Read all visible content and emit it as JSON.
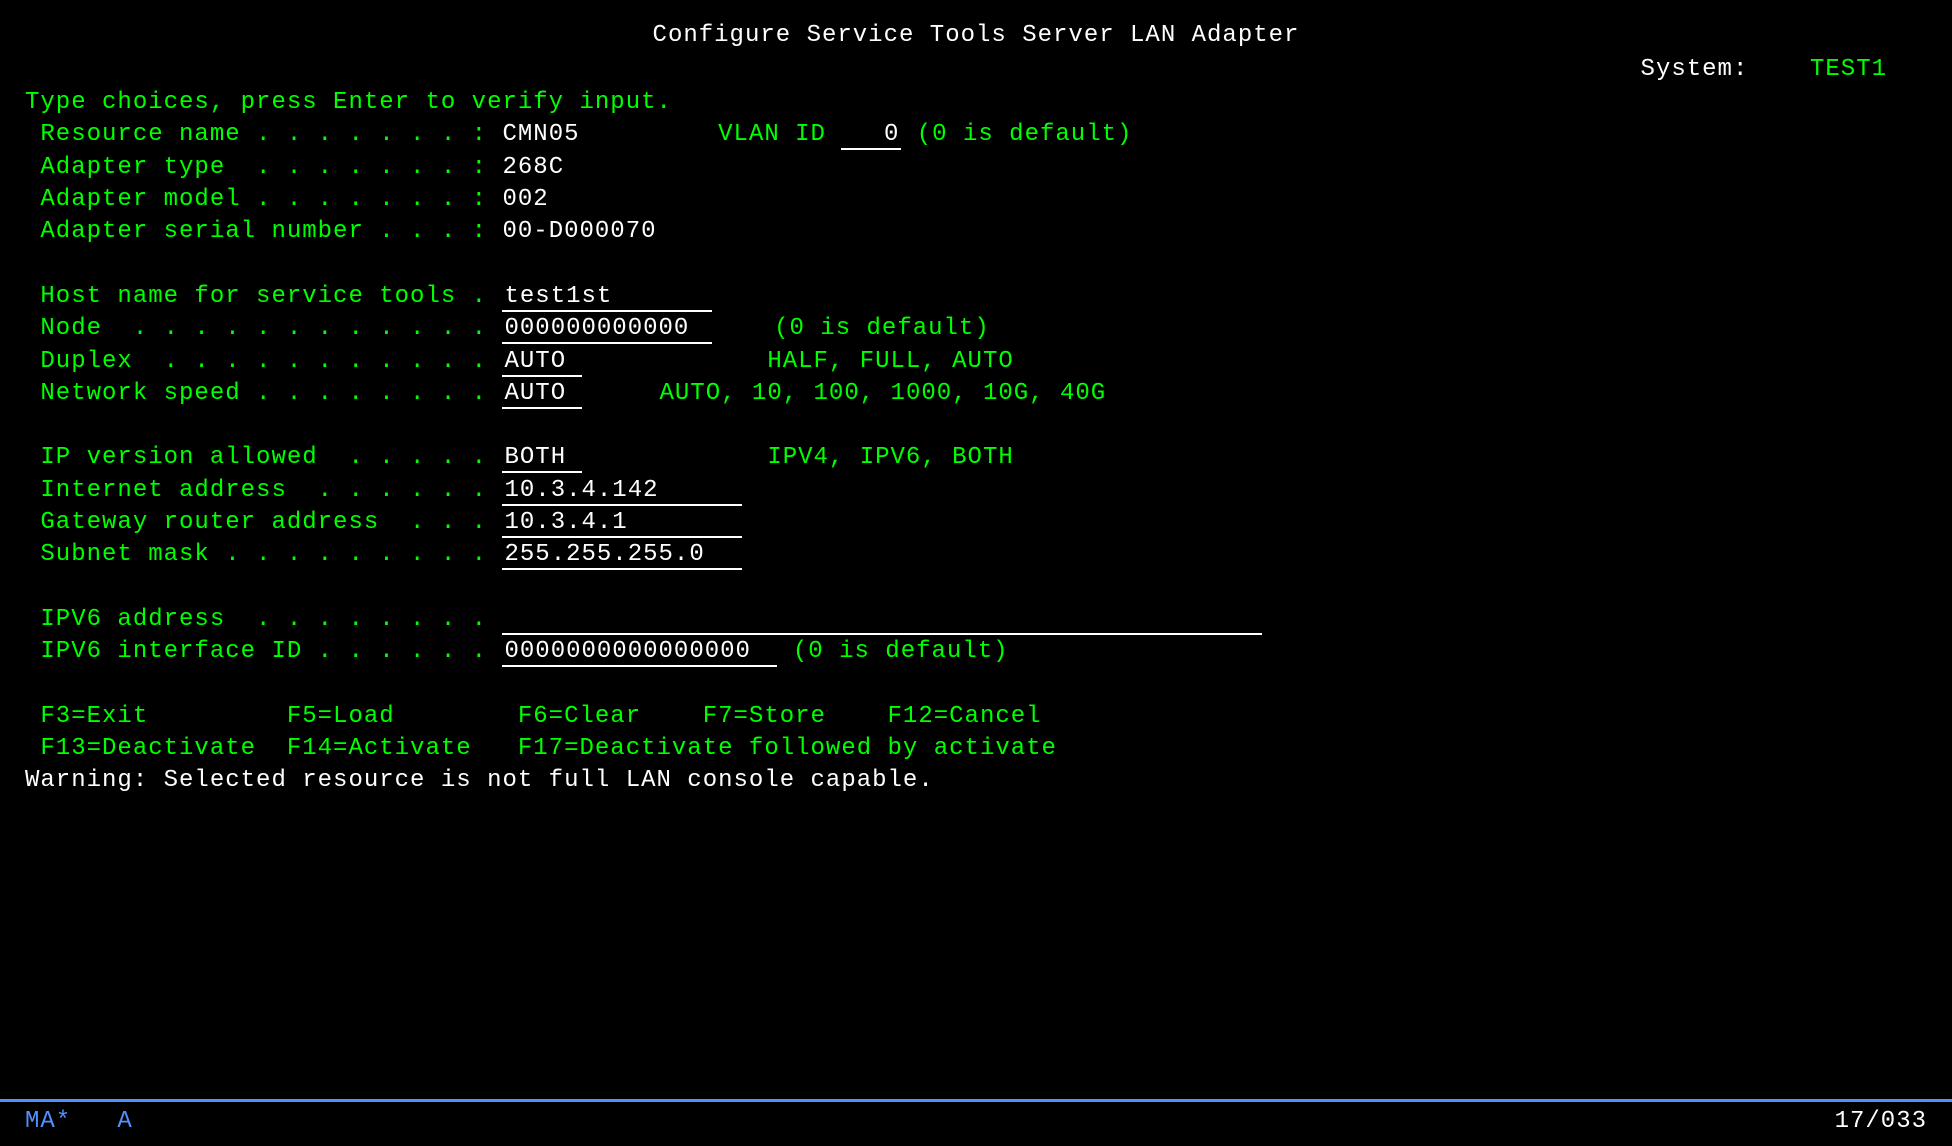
{
  "title": "Configure Service Tools Server LAN Adapter",
  "system_label": "System:",
  "system_value": "TEST1",
  "instruction": "Type choices, press Enter to verify input.",
  "fields": {
    "resource_name_label": " Resource name . . . . . . . :",
    "resource_name_value": "CMN05",
    "vlan_label": "VLAN ID",
    "vlan_value": "0",
    "vlan_hint": "(0 is default)",
    "adapter_type_label": " Adapter type  . . . . . . . :",
    "adapter_type_value": "268C",
    "adapter_model_label": " Adapter model . . . . . . . :",
    "adapter_model_value": "002",
    "adapter_serial_label": " Adapter serial number . . . :",
    "adapter_serial_value": "00-D000070",
    "hostname_label": " Host name for service tools .",
    "hostname_value": "test1st",
    "node_label": " Node  . . . . . . . . . . . .",
    "node_value": "000000000000",
    "node_hint": "(0 is default)",
    "duplex_label": " Duplex  . . . . . . . . . . .",
    "duplex_value": "AUTO",
    "duplex_hint": "HALF, FULL, AUTO",
    "netspeed_label": " Network speed . . . . . . . .",
    "netspeed_value": "AUTO",
    "netspeed_hint": "AUTO, 10, 100, 1000, 10G, 40G",
    "ipver_label": " IP version allowed  . . . . .",
    "ipver_value": "BOTH",
    "ipver_hint": "IPV4, IPV6, BOTH",
    "inet_label": " Internet address  . . . . . .",
    "inet_value": "10.3.4.142",
    "gateway_label": " Gateway router address  . . .",
    "gateway_value": "10.3.4.1",
    "subnet_label": " Subnet mask . . . . . . . . .",
    "subnet_value": "255.255.255.0",
    "ipv6_label": " IPV6 address  . . . . . . . .",
    "ipv6_value": "",
    "ipv6id_label": " IPV6 interface ID . . . . . .",
    "ipv6id_value": "0000000000000000",
    "ipv6id_hint": "(0 is default)"
  },
  "fkeys": {
    "line1": " F3=Exit         F5=Load        F6=Clear    F7=Store    F12=Cancel",
    "line2": " F13=Deactivate  F14=Activate   F17=Deactivate followed by activate"
  },
  "warning": "Warning: Selected resource is not full LAN console capable.",
  "status": {
    "left": "MA*   A",
    "right": "17/033"
  }
}
